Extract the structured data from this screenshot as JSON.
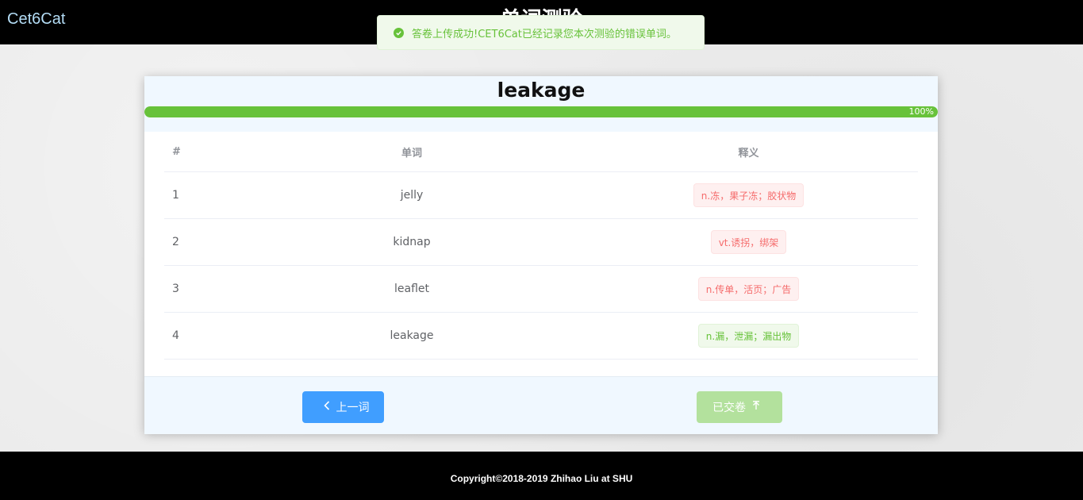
{
  "header": {
    "brand": "Cet6Cat",
    "page_heading": "单词测验"
  },
  "toast": {
    "icon": "check-circle-icon",
    "message": "答卷上传成功!CET6Cat已经记录您本次测验的错误单词。",
    "color": "#67c23a"
  },
  "quiz": {
    "current_word": "leakage",
    "progress_fraction": 1.0,
    "progress_label": "100%",
    "progress_color": "#67c23a",
    "columns": {
      "index": "#",
      "word": "单词",
      "meaning": "释义"
    },
    "rows": [
      {
        "index": "1",
        "word": "jelly",
        "meaning": "n.冻，果子冻；胶状物",
        "status": "wrong"
      },
      {
        "index": "2",
        "word": "kidnap",
        "meaning": "vt.诱拐，绑架",
        "status": "wrong"
      },
      {
        "index": "3",
        "word": "leaflet",
        "meaning": "n.传单，活页；广告",
        "status": "wrong"
      },
      {
        "index": "4",
        "word": "leakage",
        "meaning": "n.漏，泄漏；漏出物",
        "status": "right"
      }
    ],
    "buttons": {
      "prev_label": "上一词",
      "prev_icon": "chevron-left-icon",
      "submitted_label": "已交卷",
      "submitted_icon": "arrow-up-icon"
    }
  },
  "footer": {
    "copyright": "Copyright©2018-2019 Zhihao Liu at SHU"
  }
}
